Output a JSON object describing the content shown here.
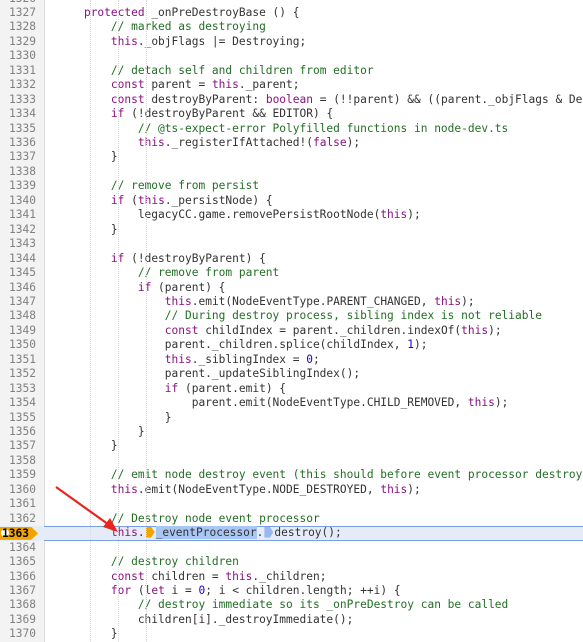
{
  "editor": {
    "current_line": "1363",
    "lines": [
      {
        "n": "1326",
        "parts": []
      },
      {
        "n": "1327",
        "parts": [
          [
            "    ",
            ""
          ],
          [
            "protected",
            "kw"
          ],
          [
            " _onPreDestroyBase () {",
            ""
          ]
        ]
      },
      {
        "n": "1328",
        "parts": [
          [
            "        ",
            ""
          ],
          [
            "// marked as destroying",
            "cm"
          ]
        ]
      },
      {
        "n": "1329",
        "parts": [
          [
            "        ",
            ""
          ],
          [
            "this",
            "kw"
          ],
          [
            "._objFlags |= Destroying;",
            ""
          ]
        ]
      },
      {
        "n": "1330",
        "parts": []
      },
      {
        "n": "1331",
        "parts": [
          [
            "        ",
            ""
          ],
          [
            "// detach self and children from editor",
            "cm"
          ]
        ]
      },
      {
        "n": "1332",
        "parts": [
          [
            "        ",
            ""
          ],
          [
            "const",
            "kw"
          ],
          [
            " parent = ",
            ""
          ],
          [
            "this",
            "kw"
          ],
          [
            "._parent;",
            ""
          ]
        ]
      },
      {
        "n": "1333",
        "parts": [
          [
            "        ",
            ""
          ],
          [
            "const",
            "kw"
          ],
          [
            " destroyByParent: ",
            ""
          ],
          [
            "boolean",
            "kw"
          ],
          [
            " = (!!parent) && ((parent._objFlags & Dest",
            ""
          ]
        ]
      },
      {
        "n": "1334",
        "parts": [
          [
            "        ",
            ""
          ],
          [
            "if",
            "kw"
          ],
          [
            " (!destroyByParent && EDITOR) {",
            ""
          ]
        ]
      },
      {
        "n": "1335",
        "parts": [
          [
            "            ",
            ""
          ],
          [
            "// @ts-expect-error Polyfilled functions in node-dev.ts",
            "cm"
          ]
        ]
      },
      {
        "n": "1336",
        "parts": [
          [
            "            ",
            ""
          ],
          [
            "this",
            "kw"
          ],
          [
            "._registerIfAttached!(",
            ""
          ],
          [
            "false",
            "kw"
          ],
          [
            ");",
            ""
          ]
        ]
      },
      {
        "n": "1337",
        "parts": [
          [
            "        }",
            ""
          ]
        ]
      },
      {
        "n": "1338",
        "parts": []
      },
      {
        "n": "1339",
        "parts": [
          [
            "        ",
            ""
          ],
          [
            "// remove from persist",
            "cm"
          ]
        ]
      },
      {
        "n": "1340",
        "parts": [
          [
            "        ",
            ""
          ],
          [
            "if",
            "kw"
          ],
          [
            " (",
            ""
          ],
          [
            "this",
            "kw"
          ],
          [
            "._persistNode) {",
            ""
          ]
        ]
      },
      {
        "n": "1341",
        "parts": [
          [
            "            legacyCC.game.removePersistRootNode(",
            ""
          ],
          [
            "this",
            "kw"
          ],
          [
            ");",
            ""
          ]
        ]
      },
      {
        "n": "1342",
        "parts": [
          [
            "        }",
            ""
          ]
        ]
      },
      {
        "n": "1343",
        "parts": []
      },
      {
        "n": "1344",
        "parts": [
          [
            "        ",
            ""
          ],
          [
            "if",
            "kw"
          ],
          [
            " (!destroyByParent) {",
            ""
          ]
        ]
      },
      {
        "n": "1345",
        "parts": [
          [
            "            ",
            ""
          ],
          [
            "// remove from parent",
            "cm"
          ]
        ]
      },
      {
        "n": "1346",
        "parts": [
          [
            "            ",
            ""
          ],
          [
            "if",
            "kw"
          ],
          [
            " (parent) {",
            ""
          ]
        ]
      },
      {
        "n": "1347",
        "parts": [
          [
            "                ",
            ""
          ],
          [
            "this",
            "kw"
          ],
          [
            ".emit(NodeEventType.PARENT_CHANGED, ",
            ""
          ],
          [
            "this",
            "kw"
          ],
          [
            ");",
            ""
          ]
        ]
      },
      {
        "n": "1348",
        "parts": [
          [
            "                ",
            ""
          ],
          [
            "// During destroy process, sibling index is not reliable",
            "cm"
          ]
        ]
      },
      {
        "n": "1349",
        "parts": [
          [
            "                ",
            ""
          ],
          [
            "const",
            "kw"
          ],
          [
            " childIndex = parent._children.indexOf(",
            ""
          ],
          [
            "this",
            "kw"
          ],
          [
            ");",
            ""
          ]
        ]
      },
      {
        "n": "1350",
        "parts": [
          [
            "                parent._children.splice(childIndex, ",
            ""
          ],
          [
            "1",
            "num"
          ],
          [
            ");",
            ""
          ]
        ]
      },
      {
        "n": "1351",
        "parts": [
          [
            "                ",
            ""
          ],
          [
            "this",
            "kw"
          ],
          [
            "._siblingIndex = ",
            ""
          ],
          [
            "0",
            "num"
          ],
          [
            ";",
            ""
          ]
        ]
      },
      {
        "n": "1352",
        "parts": [
          [
            "                parent._updateSiblingIndex();",
            ""
          ]
        ]
      },
      {
        "n": "1353",
        "parts": [
          [
            "                ",
            ""
          ],
          [
            "if",
            "kw"
          ],
          [
            " (parent.emit) {",
            ""
          ]
        ]
      },
      {
        "n": "1354",
        "parts": [
          [
            "                    parent.emit(NodeEventType.CHILD_REMOVED, ",
            ""
          ],
          [
            "this",
            "kw"
          ],
          [
            ");",
            ""
          ]
        ]
      },
      {
        "n": "1355",
        "parts": [
          [
            "                }",
            ""
          ]
        ]
      },
      {
        "n": "1356",
        "parts": [
          [
            "            }",
            ""
          ]
        ]
      },
      {
        "n": "1357",
        "parts": [
          [
            "        }",
            ""
          ]
        ]
      },
      {
        "n": "1358",
        "parts": []
      },
      {
        "n": "1359",
        "parts": [
          [
            "        ",
            ""
          ],
          [
            "// emit node destroy event (this should before event processor destroy)",
            "cm"
          ]
        ]
      },
      {
        "n": "1360",
        "parts": [
          [
            "        ",
            ""
          ],
          [
            "this",
            "kw"
          ],
          [
            ".emit(NodeEventType.NODE_DESTROYED, ",
            ""
          ],
          [
            "this",
            "kw"
          ],
          [
            ");",
            ""
          ]
        ]
      },
      {
        "n": "1361",
        "parts": []
      },
      {
        "n": "1362",
        "parts": [
          [
            "        ",
            ""
          ],
          [
            "// Destroy node event processor",
            "cm"
          ]
        ]
      },
      {
        "n": "1363",
        "current": true,
        "parts": [
          [
            "        ",
            ""
          ],
          [
            "this",
            "kw"
          ],
          [
            ".",
            ""
          ],
          [
            "BP1",
            "bp"
          ],
          [
            "_eventProcessor",
            "sel"
          ],
          [
            ".",
            ""
          ],
          [
            "BP2",
            "bp2"
          ],
          [
            "destroy();",
            ""
          ]
        ]
      },
      {
        "n": "1364",
        "parts": []
      },
      {
        "n": "1365",
        "parts": [
          [
            "        ",
            ""
          ],
          [
            "// destroy children",
            "cm"
          ]
        ]
      },
      {
        "n": "1366",
        "parts": [
          [
            "        ",
            ""
          ],
          [
            "const",
            "kw"
          ],
          [
            " children = ",
            ""
          ],
          [
            "this",
            "kw"
          ],
          [
            "._children;",
            ""
          ]
        ]
      },
      {
        "n": "1367",
        "parts": [
          [
            "        ",
            ""
          ],
          [
            "for",
            "kw"
          ],
          [
            " (",
            ""
          ],
          [
            "let",
            "kw"
          ],
          [
            " i = ",
            ""
          ],
          [
            "0",
            "num"
          ],
          [
            "; i < children.length; ++i) {",
            ""
          ]
        ]
      },
      {
        "n": "1368",
        "parts": [
          [
            "            ",
            ""
          ],
          [
            "// destroy immediate so its _onPreDestroy can be called",
            "cm"
          ]
        ]
      },
      {
        "n": "1369",
        "parts": [
          [
            "            children[i]._destroyImmediate();",
            ""
          ]
        ]
      },
      {
        "n": "1370",
        "parts": [
          [
            "        }",
            ""
          ]
        ]
      }
    ]
  }
}
